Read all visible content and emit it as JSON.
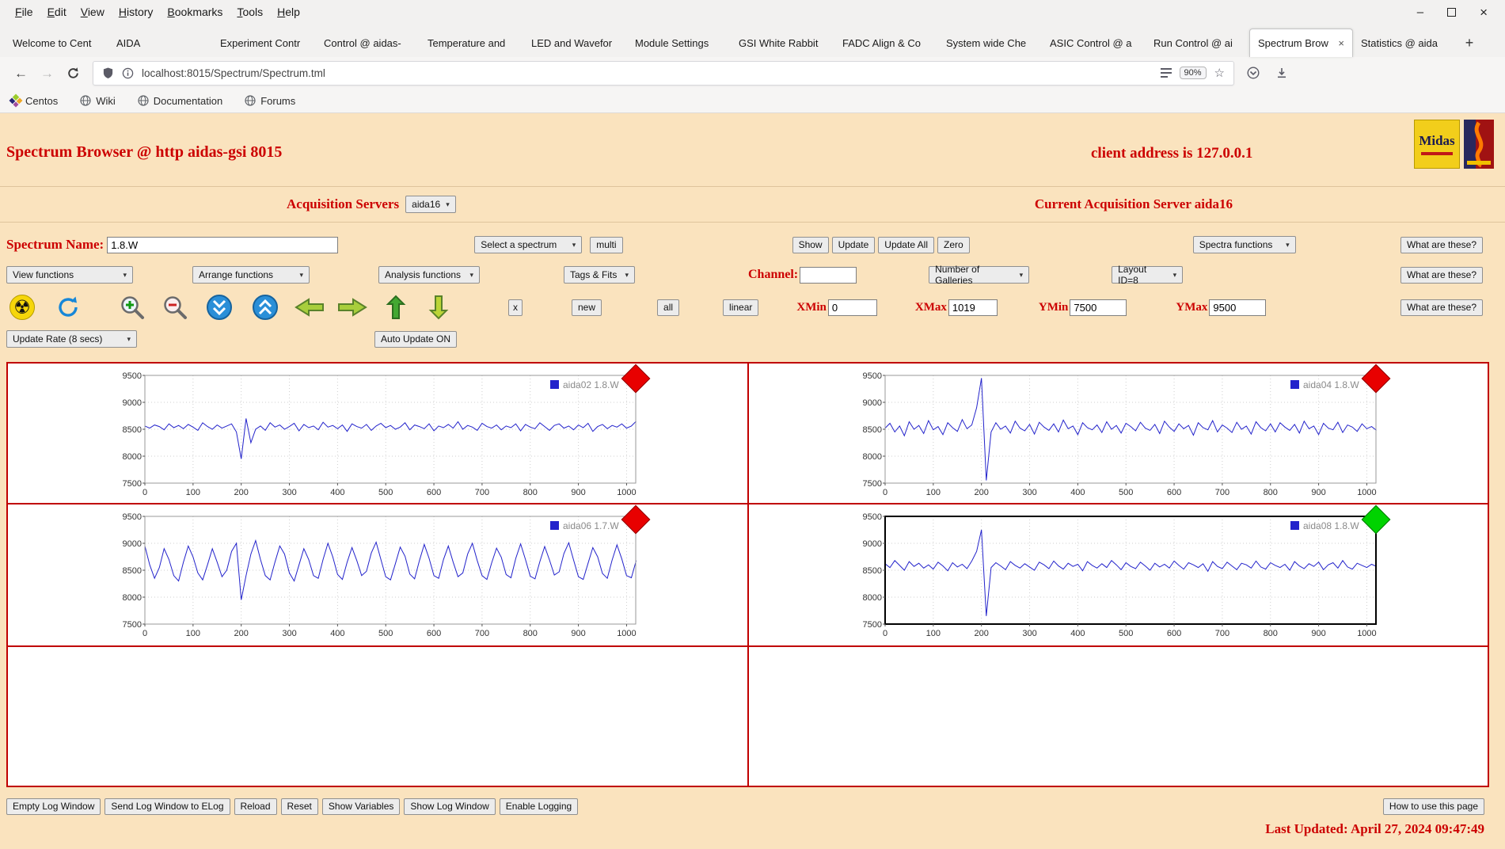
{
  "browser": {
    "menu_items": [
      "File",
      "Edit",
      "View",
      "History",
      "Bookmarks",
      "Tools",
      "Help"
    ],
    "tabs": [
      "Welcome to Cent",
      "AIDA",
      "Experiment Contr",
      "Control @ aidas-",
      "Temperature and",
      "LED and Wavefor",
      "Module Settings",
      "GSI White Rabbit",
      "FADC Align & Co",
      "System wide Che",
      "ASIC Control @ a",
      "Run Control @ ai",
      "Spectrum Brow",
      "Statistics @ aida"
    ],
    "active_tab": "Spectrum Brow",
    "url": "localhost:8015/Spectrum/Spectrum.tml",
    "zoom_level": "90%",
    "bookmarks": [
      "Centos",
      "Wiki",
      "Documentation",
      "Forums"
    ]
  },
  "header": {
    "title": "Spectrum Browser @ http aidas-gsi 8015",
    "client_address": "client address is 127.0.0.1",
    "midas_logo_text": "Midas"
  },
  "acquisition": {
    "label": "Acquisition Servers",
    "selected_server": "aida16",
    "current_server_text": "Current Acquisition Server aida16"
  },
  "controls": {
    "spectrum_name_label": "Spectrum Name:",
    "spectrum_name_value": "1.8.W",
    "select_spectrum_label": "Select a spectrum",
    "multi_button": "multi",
    "show_button": "Show",
    "update_button": "Update",
    "update_all_button": "Update All",
    "zero_button": "Zero",
    "spectra_functions_label": "Spectra functions",
    "what_are_these_button": "What are these?",
    "view_functions_label": "View functions",
    "arrange_functions_label": "Arrange functions",
    "analysis_functions_label": "Analysis functions",
    "tags_fits_label": "Tags & Fits",
    "channel_label": "Channel:",
    "channel_value": "",
    "galleries_label": "Number of Galleries",
    "layout_label": "Layout ID=8",
    "x_button": "x",
    "new_button": "new",
    "all_button": "all",
    "linear_button": "linear",
    "xmin_label": "XMin",
    "xmin_value": "0",
    "xmax_label": "XMax",
    "xmax_value": "1019",
    "ymin_label": "YMin",
    "ymin_value": "7500",
    "ymax_label": "YMax",
    "ymax_value": "9500",
    "update_rate_label": "Update Rate (8 secs)",
    "auto_update_button": "Auto Update ON"
  },
  "icons": {
    "radiation-icon": "☢",
    "refresh-icon": "circular-blue-arrow",
    "zoom-in-icon": "magnifier-plus",
    "zoom-out-icon": "magnifier-minus",
    "compress-y-icon": "blue-circle-double-chevron-down",
    "expand-y-icon": "blue-circle-double-chevron-up",
    "move-left-icon": "green-arrow-left",
    "move-right-icon": "green-arrow-right",
    "move-up-icon": "green-arrow-up",
    "move-down-icon": "green-arrow-down"
  },
  "footer": {
    "buttons": [
      "Empty Log Window",
      "Send Log Window to ELog",
      "Reload",
      "Reset",
      "Show Variables",
      "Show Log Window",
      "Enable Logging"
    ],
    "help_button": "How to use this page",
    "last_updated": "Last Updated: April 27, 2024 09:47:49"
  },
  "colors": {
    "accent_red": "#cc0000",
    "page_bg": "#fae3be",
    "line_blue": "#2323cb",
    "marker_red": "#e80000",
    "marker_green": "#00d300"
  },
  "chart_data": [
    {
      "type": "line",
      "title": "aida02 1.8.W",
      "legend": "aida02 1.8.W",
      "x_start": 0,
      "x_step": 10,
      "xlim": [
        0,
        1019
      ],
      "ylim": [
        7500,
        9500
      ],
      "xticks": [
        0,
        100,
        200,
        300,
        400,
        500,
        600,
        700,
        800,
        900,
        1000
      ],
      "yticks": [
        7500,
        8000,
        8500,
        9000,
        9500
      ],
      "line_color": "#2323cb",
      "marker": "red",
      "selected": false,
      "values": [
        8560,
        8520,
        8580,
        8550,
        8490,
        8600,
        8530,
        8570,
        8510,
        8590,
        8540,
        8480,
        8620,
        8550,
        8500,
        8580,
        8520,
        8560,
        8600,
        8450,
        7950,
        8700,
        8250,
        8500,
        8560,
        8480,
        8620,
        8540,
        8580,
        8500,
        8550,
        8610,
        8470,
        8590,
        8530,
        8560,
        8490,
        8630,
        8540,
        8570,
        8510,
        8580,
        8460,
        8600,
        8550,
        8520,
        8590,
        8480,
        8560,
        8610,
        8530,
        8570,
        8500,
        8540,
        8620,
        8490,
        8580,
        8550,
        8510,
        8600,
        8470,
        8560,
        8530,
        8590,
        8520,
        8640,
        8500,
        8570,
        8540,
        8480,
        8610,
        8550,
        8520,
        8580,
        8490,
        8560,
        8530,
        8600,
        8470,
        8590,
        8540,
        8510,
        8620,
        8550,
        8480,
        8570,
        8600,
        8520,
        8560,
        8490,
        8580,
        8530,
        8610,
        8460,
        8550,
        8590,
        8510,
        8570,
        8540,
        8600,
        8520,
        8560,
        8650
      ]
    },
    {
      "type": "line",
      "title": "aida04 1.8.W",
      "legend": "aida04 1.8.W",
      "x_start": 0,
      "x_step": 10,
      "xlim": [
        0,
        1019
      ],
      "ylim": [
        7500,
        9500
      ],
      "xticks": [
        0,
        100,
        200,
        300,
        400,
        500,
        600,
        700,
        800,
        900,
        1000
      ],
      "yticks": [
        7500,
        8000,
        8500,
        9000,
        9500
      ],
      "line_color": "#2323cb",
      "marker": "red",
      "selected": false,
      "values": [
        8520,
        8610,
        8450,
        8560,
        8380,
        8640,
        8500,
        8570,
        8420,
        8660,
        8490,
        8550,
        8400,
        8620,
        8530,
        8460,
        8680,
        8510,
        8580,
        8900,
        9450,
        7550,
        8450,
        8620,
        8500,
        8560,
        8430,
        8650,
        8520,
        8470,
        8590,
        8410,
        8630,
        8540,
        8480,
        8600,
        8450,
        8670,
        8510,
        8560,
        8400,
        8620,
        8530,
        8490,
        8580,
        8440,
        8640,
        8500,
        8570,
        8430,
        8610,
        8550,
        8470,
        8630,
        8520,
        8480,
        8590,
        8420,
        8650,
        8540,
        8460,
        8600,
        8510,
        8570,
        8390,
        8620,
        8530,
        8490,
        8660,
        8450,
        8580,
        8520,
        8440,
        8630,
        8500,
        8560,
        8410,
        8640,
        8530,
        8470,
        8600,
        8450,
        8620,
        8540,
        8480,
        8590,
        8430,
        8650,
        8510,
        8560,
        8400,
        8610,
        8520,
        8490,
        8630,
        8440,
        8580,
        8540,
        8460,
        8600,
        8510,
        8550,
        8480
      ]
    },
    {
      "type": "line",
      "title": "aida06 1.7.W",
      "legend": "aida06 1.7.W",
      "x_start": 0,
      "x_step": 10,
      "xlim": [
        0,
        1019
      ],
      "ylim": [
        7500,
        9500
      ],
      "xticks": [
        0,
        100,
        200,
        300,
        400,
        500,
        600,
        700,
        800,
        900,
        1000
      ],
      "yticks": [
        7500,
        8000,
        8500,
        9000,
        9500
      ],
      "line_color": "#2323cb",
      "marker": "red",
      "selected": false,
      "values": [
        8950,
        8600,
        8350,
        8550,
        8900,
        8700,
        8400,
        8300,
        8650,
        8950,
        8750,
        8450,
        8320,
        8600,
        8900,
        8650,
        8380,
        8500,
        8850,
        9000,
        7950,
        8400,
        8800,
        9050,
        8700,
        8400,
        8320,
        8650,
        8950,
        8800,
        8450,
        8300,
        8600,
        8900,
        8700,
        8400,
        8350,
        8700,
        9000,
        8750,
        8420,
        8330,
        8650,
        8920,
        8680,
        8400,
        8480,
        8820,
        9020,
        8700,
        8380,
        8320,
        8620,
        8930,
        8760,
        8430,
        8340,
        8680,
        8980,
        8720,
        8400,
        8350,
        8700,
        8950,
        8650,
        8380,
        8450,
        8800,
        9000,
        8680,
        8400,
        8330,
        8640,
        8910,
        8740,
        8420,
        8360,
        8720,
        8990,
        8700,
        8390,
        8340,
        8660,
        8940,
        8690,
        8410,
        8470,
        8810,
        9010,
        8690,
        8380,
        8330,
        8630,
        8920,
        8750,
        8440,
        8350,
        8690,
        8970,
        8710,
        8400,
        8360,
        8680
      ]
    },
    {
      "type": "line",
      "title": "aida08 1.8.W",
      "legend": "aida08 1.8.W",
      "x_start": 0,
      "x_step": 10,
      "xlim": [
        0,
        1019
      ],
      "ylim": [
        7500,
        9500
      ],
      "xticks": [
        0,
        100,
        200,
        300,
        400,
        500,
        600,
        700,
        800,
        900,
        1000
      ],
      "yticks": [
        7500,
        8000,
        8500,
        9000,
        9500
      ],
      "line_color": "#2323cb",
      "marker": "green",
      "selected": true,
      "values": [
        8620,
        8550,
        8680,
        8590,
        8500,
        8660,
        8570,
        8630,
        8540,
        8600,
        8520,
        8650,
        8580,
        8490,
        8640,
        8560,
        8610,
        8530,
        8670,
        8850,
        9250,
        7650,
        8550,
        8640,
        8580,
        8510,
        8660,
        8590,
        8540,
        8620,
        8560,
        8500,
        8650,
        8600,
        8530,
        8670,
        8580,
        8520,
        8630,
        8570,
        8610,
        8490,
        8660,
        8590,
        8540,
        8620,
        8550,
        8680,
        8600,
        8510,
        8640,
        8570,
        8530,
        8650,
        8580,
        8500,
        8630,
        8560,
        8610,
        8540,
        8670,
        8590,
        8520,
        8640,
        8600,
        8550,
        8620,
        8480,
        8660,
        8570,
        8530,
        8650,
        8580,
        8510,
        8630,
        8600,
        8540,
        8670,
        8560,
        8520,
        8640,
        8590,
        8550,
        8610,
        8500,
        8660,
        8580,
        8530,
        8620,
        8570,
        8650,
        8510,
        8600,
        8640,
        8540,
        8680,
        8560,
        8520,
        8630,
        8590,
        8550,
        8610,
        8570
      ]
    }
  ]
}
